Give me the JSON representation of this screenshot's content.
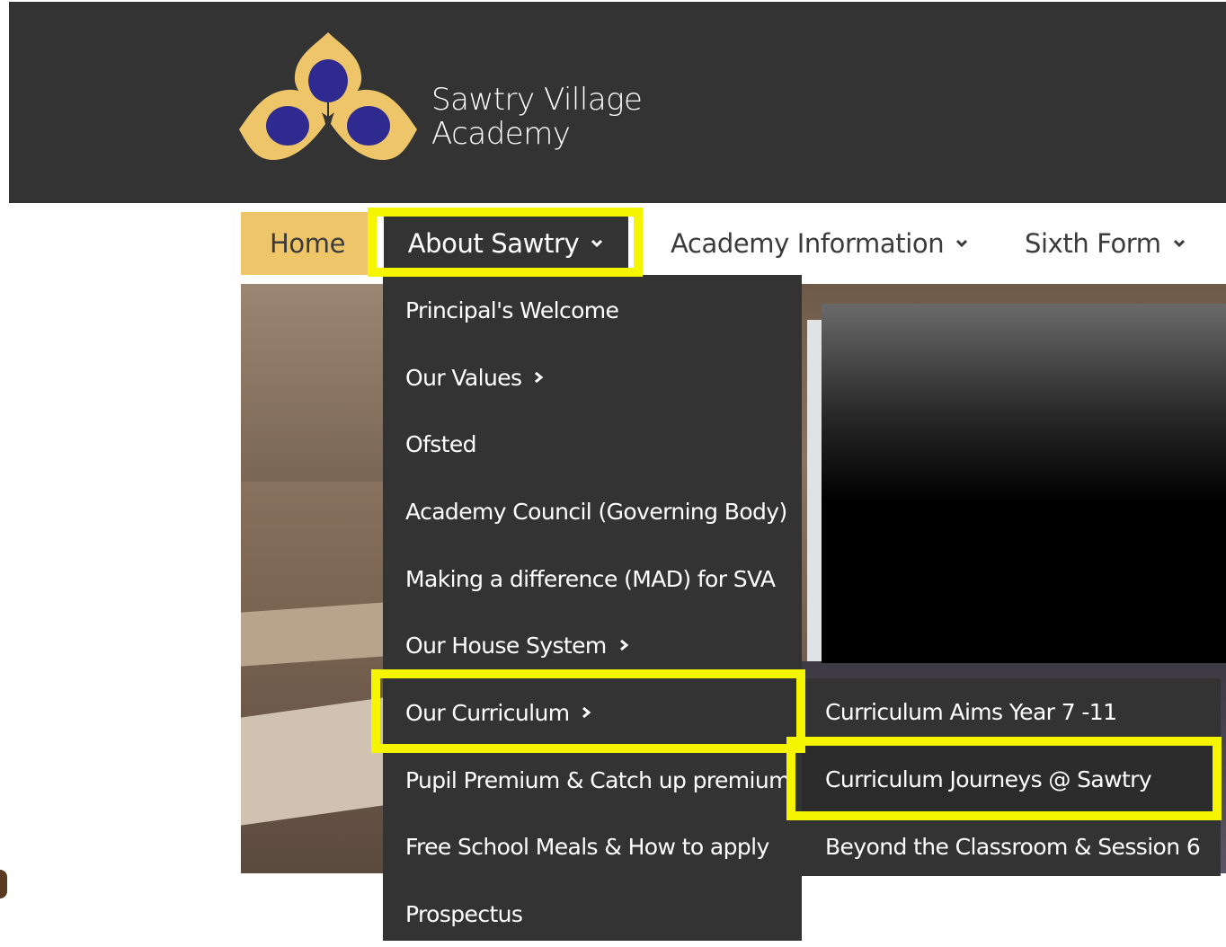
{
  "site": {
    "name_line1": "Sawtry Village",
    "name_line2": "Academy"
  },
  "colors": {
    "header_bg": "#333333",
    "accent_gold": "#efc56a",
    "logo_blue": "#2e2a8f",
    "highlight": "#f5f500"
  },
  "nav": {
    "home": "Home",
    "about": "About Sawtry",
    "academy": "Academy Information",
    "sixth_form": "Sixth Form"
  },
  "dropdown": {
    "items": [
      {
        "label": "Principal's Welcome",
        "has_submenu": false
      },
      {
        "label": "Our Values",
        "has_submenu": true
      },
      {
        "label": "Ofsted",
        "has_submenu": false
      },
      {
        "label": "Academy Council (Governing Body)",
        "has_submenu": false
      },
      {
        "label": "Making a difference (MAD) for SVA",
        "has_submenu": false
      },
      {
        "label": "Our House System",
        "has_submenu": true
      },
      {
        "label": "Our Curriculum",
        "has_submenu": true
      },
      {
        "label": "Pupil Premium & Catch up premium",
        "has_submenu": false
      },
      {
        "label": "Free School Meals & How to apply",
        "has_submenu": false
      },
      {
        "label": "Prospectus",
        "has_submenu": false
      }
    ]
  },
  "submenu": {
    "items": [
      {
        "label": "Curriculum Aims Year 7 -11"
      },
      {
        "label": "Curriculum Journeys @ Sawtry"
      },
      {
        "label": "Beyond the Classroom & Session 6"
      }
    ]
  },
  "icons": {
    "logo": "trefoil-logo-icon",
    "nav_dropdown": "chevron-down-icon",
    "submenu_arrow": "chevron-right-icon"
  }
}
